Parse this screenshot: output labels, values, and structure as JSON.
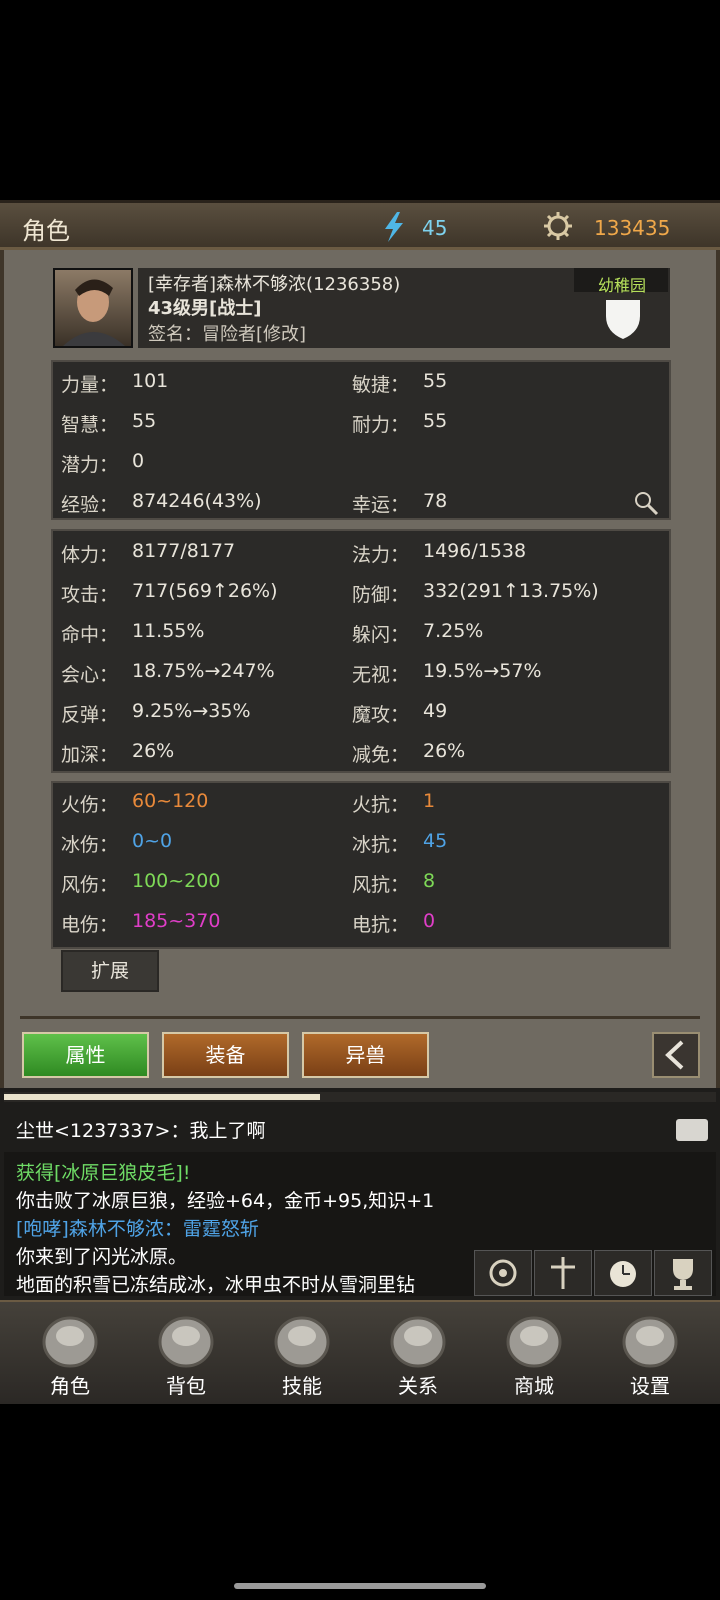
{
  "header": {
    "title": "角色",
    "energy": "45",
    "gold": "133435"
  },
  "profile": {
    "name": "[幸存者]森林不够浓(1236358)",
    "level_class": "43级男[战士]",
    "signature": "签名：冒险者[修改]",
    "badge": "幼稚园"
  },
  "base_stats": {
    "rows": [
      {
        "l1": "力量：",
        "v1": "101",
        "l2": "敏捷：",
        "v2": "55"
      },
      {
        "l1": "智慧：",
        "v1": "55",
        "l2": "耐力：",
        "v2": "55"
      },
      {
        "l1": "潜力：",
        "v1": "0",
        "l2": "",
        "v2": ""
      },
      {
        "l1": "经验：",
        "v1": "874246(43%)",
        "l2": "幸运：",
        "v2": "78"
      }
    ]
  },
  "combat_stats": {
    "rows": [
      {
        "l1": "体力：",
        "v1": "8177/8177",
        "l2": "法力：",
        "v2": "1496/1538"
      },
      {
        "l1": "攻击：",
        "v1": "717(569↑26%)",
        "l2": "防御：",
        "v2": "332(291↑13.75%)"
      },
      {
        "l1": "命中：",
        "v1": "11.55%",
        "l2": "躲闪：",
        "v2": "7.25%"
      },
      {
        "l1": "会心：",
        "v1": "18.75%→247%",
        "l2": "无视：",
        "v2": "19.5%→57%"
      },
      {
        "l1": "反弹：",
        "v1": "9.25%→35%",
        "l2": "魔攻：",
        "v2": "49"
      },
      {
        "l1": "加深：",
        "v1": "26%",
        "l2": "减免：",
        "v2": "26%"
      }
    ]
  },
  "element_stats": {
    "rows": [
      {
        "l1": "火伤：",
        "v1": "60~120",
        "l2": "火抗：",
        "v2": "1",
        "color": "#e8893a"
      },
      {
        "l1": "冰伤：",
        "v1": "0~0",
        "l2": "冰抗：",
        "v2": "45",
        "color": "#4fa3e6"
      },
      {
        "l1": "风伤：",
        "v1": "100~200",
        "l2": "风抗：",
        "v2": "8",
        "color": "#7ed957"
      },
      {
        "l1": "电伤：",
        "v1": "185~370",
        "l2": "电抗：",
        "v2": "0",
        "color": "#e03ec8"
      }
    ]
  },
  "expand_button": "扩展",
  "tabs": [
    "属性",
    "装备",
    "异兽"
  ],
  "chat": {
    "world_line": "尘世<1237337>：我上了啊",
    "log": [
      {
        "text": "获得[冰原巨狼皮毛]!",
        "color": "#6fdc66"
      },
      {
        "text": "你击败了冰原巨狼，经验+64，金币+95,知识+1",
        "color": "#ffffff"
      },
      {
        "text": "[咆哮]森林不够浓：雷霆怒斩",
        "color": "#4fa3e6"
      },
      {
        "text": "你来到了闪光冰原。",
        "color": "#ffffff"
      },
      {
        "text": "地面的积雪已冻结成冰，冰甲虫不时从雪洞里钻",
        "color": "#ffffff"
      }
    ]
  },
  "nav": [
    "角色",
    "背包",
    "技能",
    "关系",
    "商城",
    "设置"
  ],
  "colors": {
    "energy": "#7ed2ee",
    "gold": "#f0a84a",
    "tab_active": "#3f9a2e",
    "tab_inactive": "#9a5a22"
  }
}
